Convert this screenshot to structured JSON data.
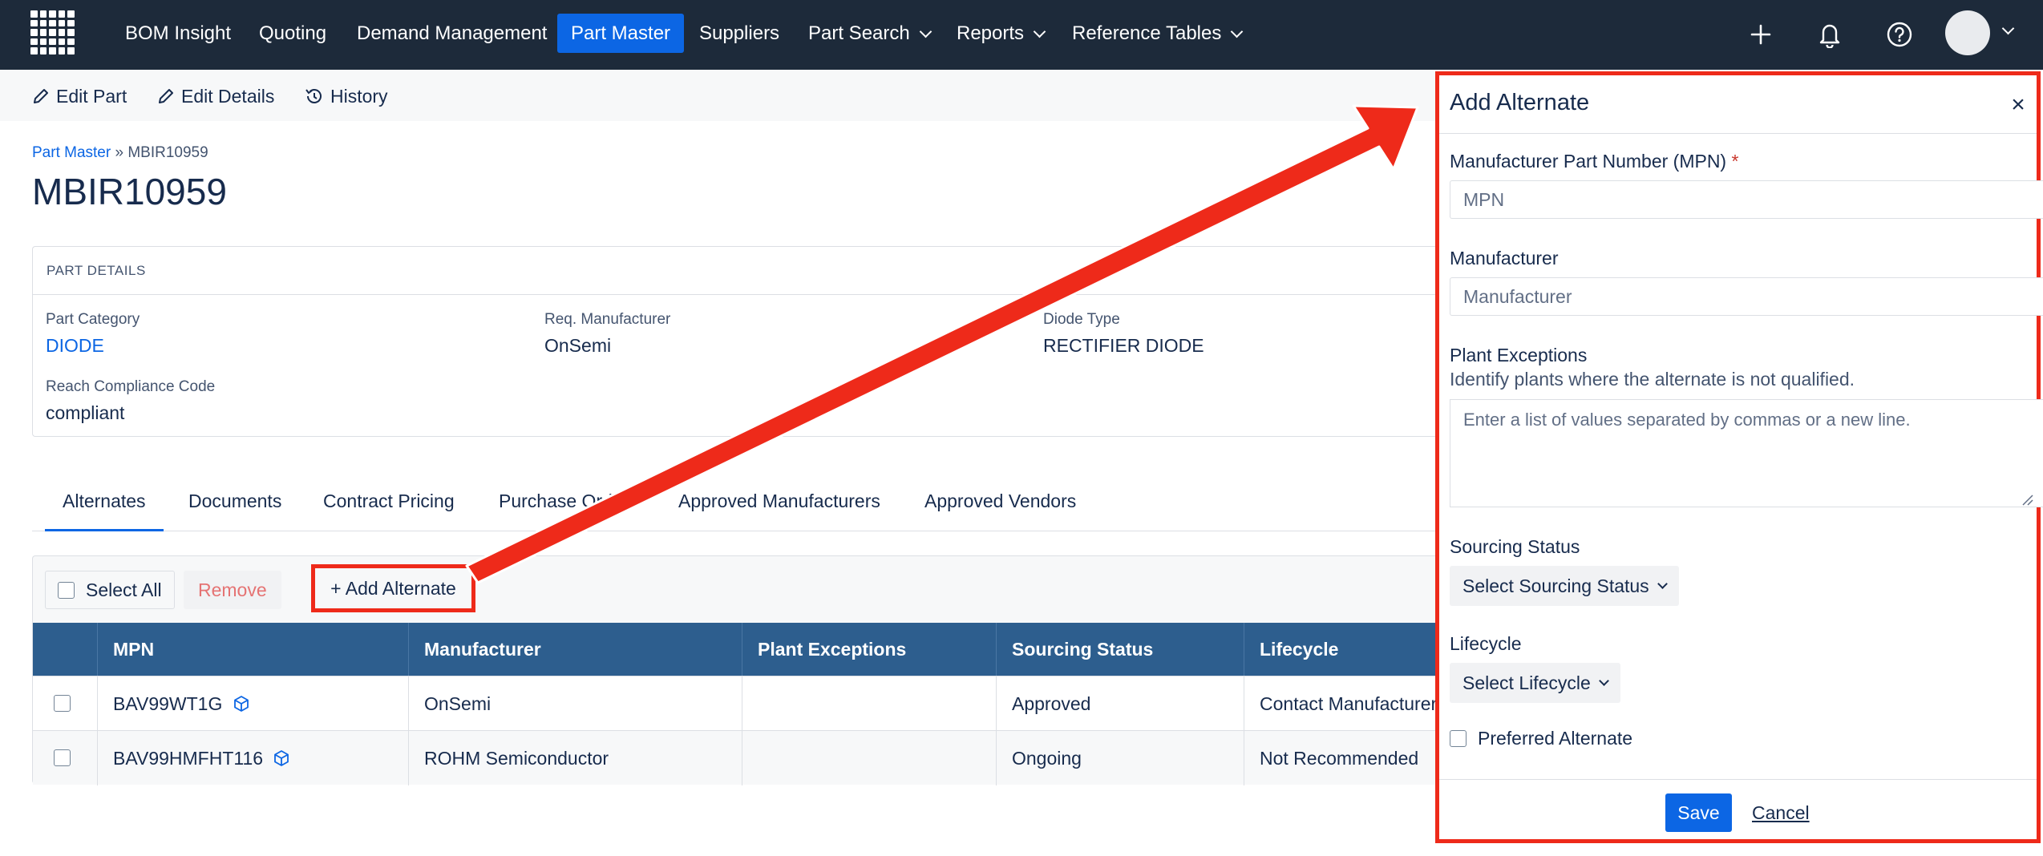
{
  "nav": {
    "items": [
      {
        "label": "BOM Insight",
        "dropdown": false,
        "active": false
      },
      {
        "label": "Quoting",
        "dropdown": false,
        "active": false
      },
      {
        "label": "Demand Management",
        "dropdown": false,
        "active": false
      },
      {
        "label": "Part Master",
        "dropdown": false,
        "active": true
      },
      {
        "label": "Suppliers",
        "dropdown": false,
        "active": false
      },
      {
        "label": "Part Search",
        "dropdown": true,
        "active": false
      },
      {
        "label": "Reports",
        "dropdown": true,
        "active": false
      },
      {
        "label": "Reference Tables",
        "dropdown": true,
        "active": false
      }
    ],
    "icons": [
      "plus-icon",
      "bell-icon",
      "help-icon",
      "avatar"
    ]
  },
  "toolbar": {
    "edit_part": "Edit Part",
    "edit_details": "Edit Details",
    "history": "History"
  },
  "breadcrumb": {
    "root": "Part Master",
    "sep": "»",
    "current": "MBIR10959"
  },
  "page_title": "MBIR10959",
  "part_details": {
    "heading": "PART DETAILS",
    "fields": [
      {
        "label": "Part Category",
        "value": "DIODE"
      },
      {
        "label": "Req. Manufacturer",
        "value": "OnSemi"
      },
      {
        "label": "Diode Type",
        "value": "RECTIFIER DIODE"
      },
      {
        "label": "Reach Compliance Code",
        "value": "compliant"
      }
    ]
  },
  "tabs": [
    {
      "label": "Alternates",
      "active": true
    },
    {
      "label": "Documents",
      "active": false
    },
    {
      "label": "Contract Pricing",
      "active": false
    },
    {
      "label": "Purchase Orders",
      "active": false
    },
    {
      "label": "Approved Manufacturers",
      "active": false
    },
    {
      "label": "Approved Vendors",
      "active": false
    }
  ],
  "grid": {
    "select_all": "Select All",
    "remove": "Remove",
    "add_alternate": "+ Add Alternate",
    "columns": [
      "MPN",
      "Manufacturer",
      "Plant Exceptions",
      "Sourcing Status",
      "Lifecycle"
    ],
    "rows": [
      {
        "mpn": "BAV99WT1G",
        "manufacturer": "OnSemi",
        "plant_exceptions": "",
        "sourcing_status": "Approved",
        "lifecycle": "Contact Manufacturer"
      },
      {
        "mpn": "BAV99HMFHT116",
        "manufacturer": "ROHM Semiconductor",
        "plant_exceptions": "",
        "sourcing_status": "Ongoing",
        "lifecycle": "Not Recommended"
      }
    ]
  },
  "panel": {
    "title": "Add Alternate",
    "close": "×",
    "mpn_label": "Manufacturer Part Number (MPN)",
    "required_mark": "*",
    "mpn_placeholder": "MPN",
    "manufacturer_label": "Manufacturer",
    "manufacturer_placeholder": "Manufacturer",
    "plant_label": "Plant Exceptions",
    "plant_help": "Identify plants where the alternate is not qualified.",
    "plant_placeholder": "Enter a list of values separated by commas or a new line.",
    "sourcing_label": "Sourcing Status",
    "sourcing_select": "Select Sourcing Status",
    "lifecycle_label": "Lifecycle",
    "lifecycle_select": "Select Lifecycle",
    "preferred_label": "Preferred Alternate",
    "save": "Save",
    "cancel": "Cancel"
  },
  "colors": {
    "nav_bg": "#1d2a3a",
    "accent": "#0c66e4",
    "table_header": "#2d5e8e",
    "annotation": "#ee2a1a"
  }
}
